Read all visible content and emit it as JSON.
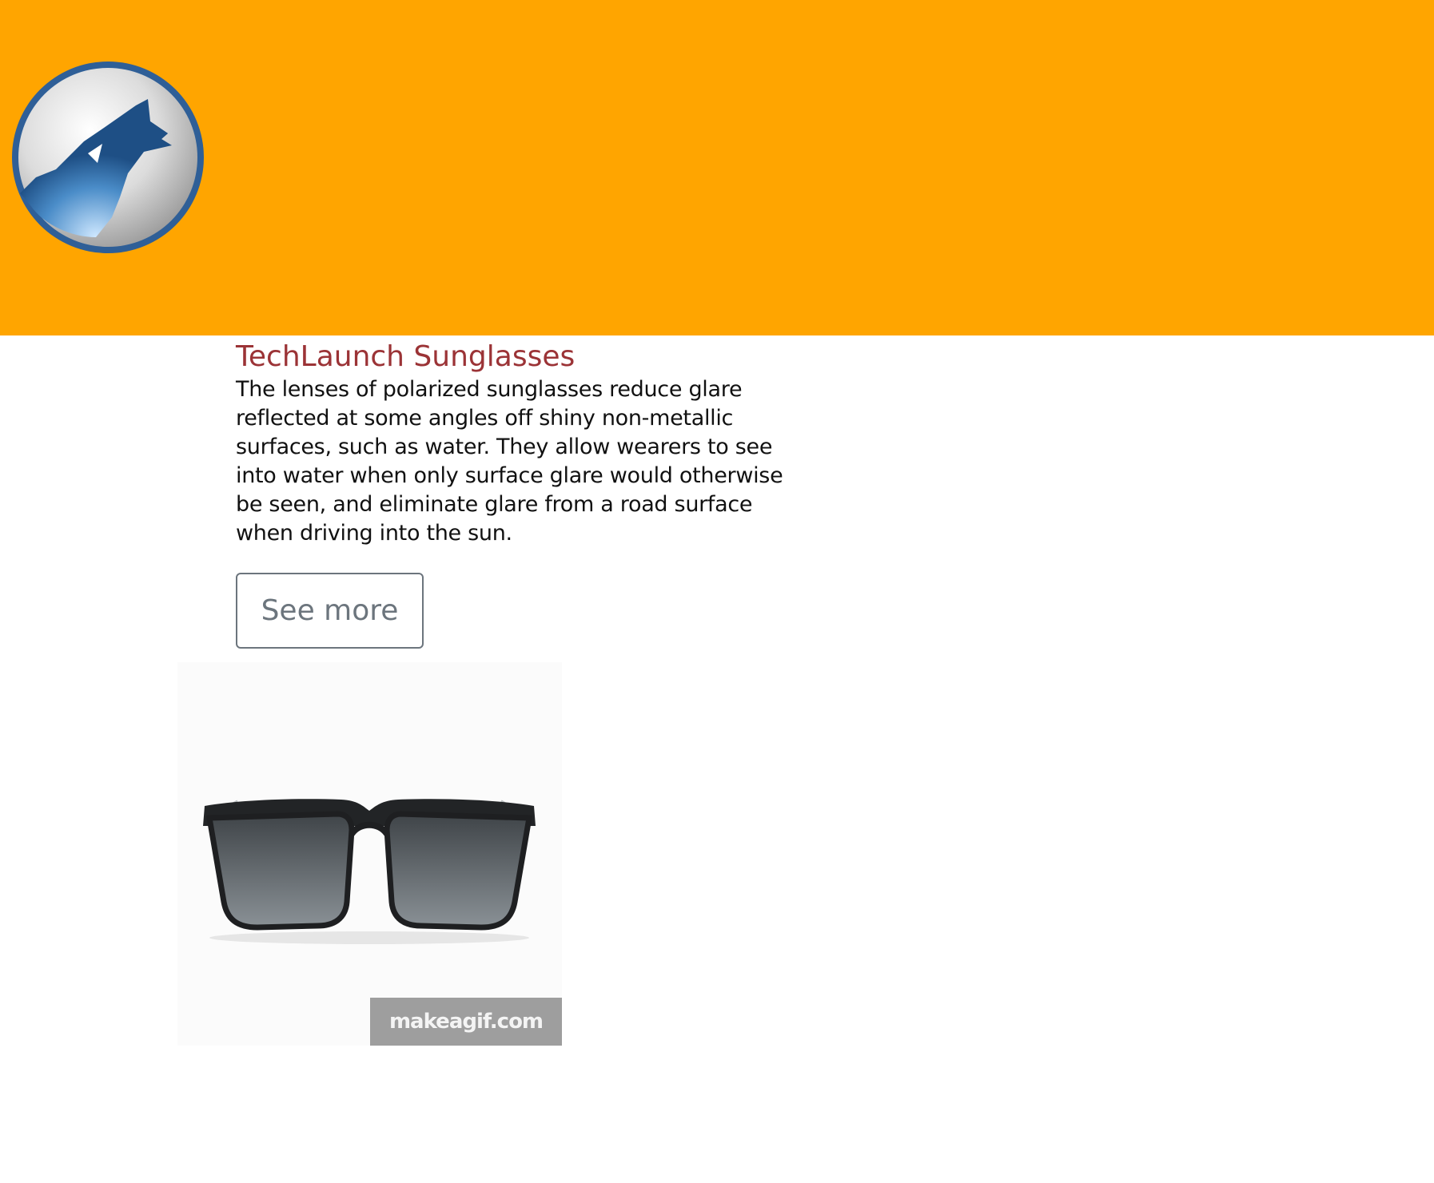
{
  "header": {
    "logo_icon": "howling-wolf-logo-icon",
    "background_color": "#FFA500"
  },
  "product": {
    "title": "TechLaunch Sunglasses",
    "description": "The lenses of polarized sunglasses reduce glare reflected at some angles off shiny non-metallic surfaces, such as water. They allow wearers to see into water when only surface glare would otherwise be seen, and eliminate glare from a road surface when driving into the sun.",
    "see_more_label": "See more",
    "image_icon": "sunglasses-image",
    "watermark": "makeagif.com"
  },
  "colors": {
    "title": "#9B3336",
    "button_border": "#6c757d"
  }
}
